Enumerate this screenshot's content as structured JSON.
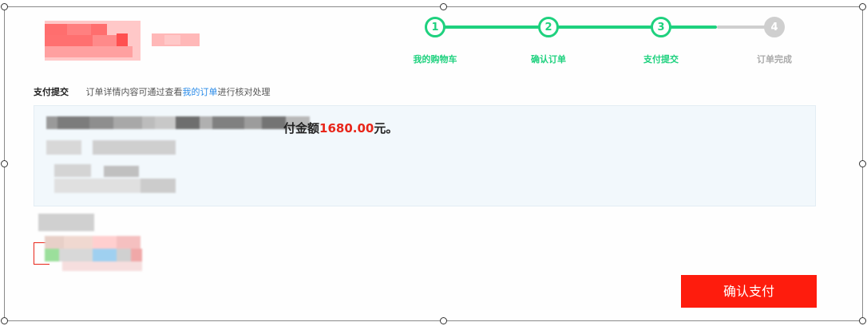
{
  "steps": [
    {
      "number": "1",
      "label": "我的购物车",
      "state": "done"
    },
    {
      "number": "2",
      "label": "确认订单",
      "state": "done"
    },
    {
      "number": "3",
      "label": "支付提交",
      "state": "current"
    },
    {
      "number": "4",
      "label": "订单完成",
      "state": "pending"
    }
  ],
  "notice": {
    "title": "支付提交",
    "text_before": "订单详情内容可通过查看",
    "link": "我的订单",
    "text_after": "进行核对处理"
  },
  "payment": {
    "amount_prefix": "付金额",
    "amount": "1680.00",
    "amount_suffix": "元。"
  },
  "actions": {
    "confirm_pay": "确认支付"
  },
  "colors": {
    "accent_green": "#1ed17e",
    "pay_red": "#fe1c0d",
    "amount_red": "#e8261a",
    "link_blue": "#2a8be8"
  }
}
